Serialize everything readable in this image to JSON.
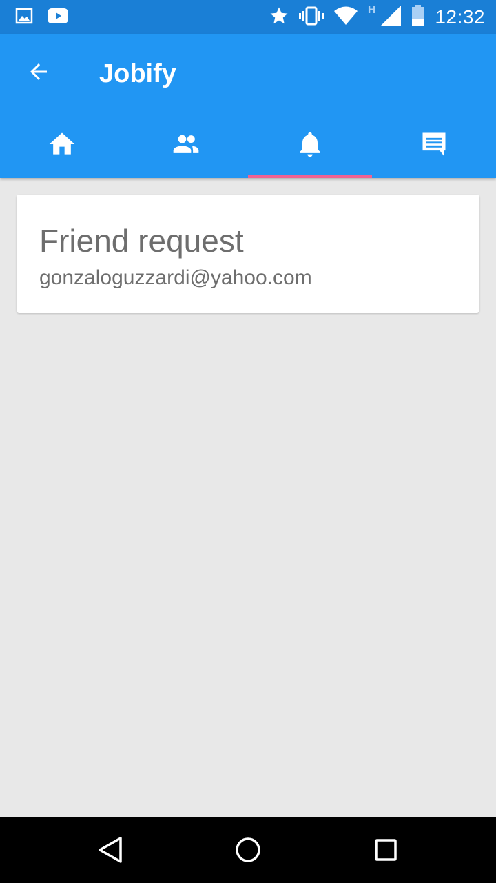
{
  "status_bar": {
    "time": "12:32",
    "network_type": "H",
    "icons": [
      "gallery-notification-icon",
      "youtube-notification-icon",
      "star-icon",
      "vibrate-icon",
      "wifi-icon",
      "signal-icon",
      "battery-icon"
    ]
  },
  "app_bar": {
    "title": "Jobify",
    "back_icon": "arrow-back-icon",
    "tabs": [
      {
        "icon": "home-icon",
        "active": false
      },
      {
        "icon": "people-icon",
        "active": false
      },
      {
        "icon": "notifications-icon",
        "active": true
      },
      {
        "icon": "chat-icon",
        "active": false
      }
    ],
    "indicator_color": "#f06292",
    "color": "#2196f3"
  },
  "notifications": [
    {
      "title": "Friend request",
      "subtitle": "gonzaloguzzardi@yahoo.com"
    }
  ],
  "nav_bar": {
    "buttons": [
      "back-triangle-icon",
      "home-circle-icon",
      "recents-square-icon"
    ]
  }
}
